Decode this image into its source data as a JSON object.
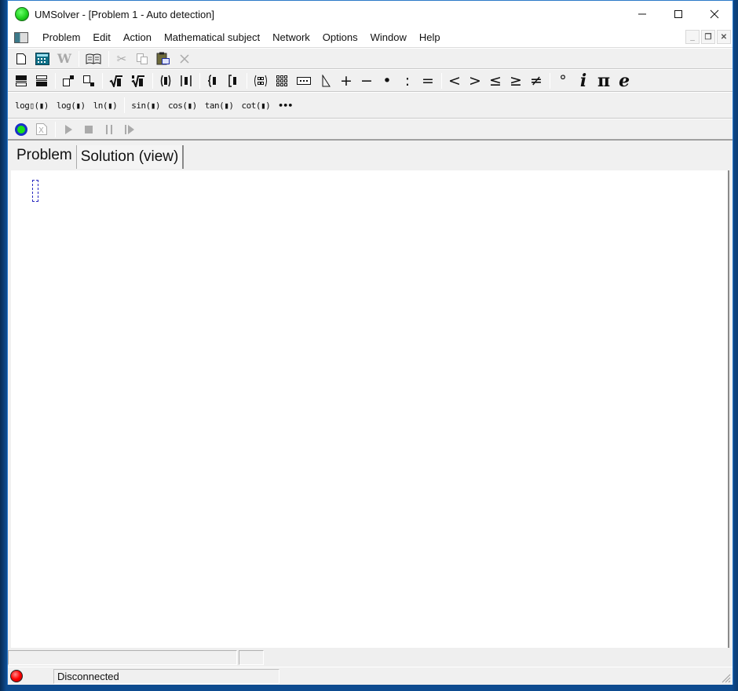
{
  "window": {
    "title": "UMSolver - [Problem 1 - Auto detection]",
    "controls": {
      "minimize": "minimize-icon",
      "maximize": "maximize-icon",
      "close": "close-icon"
    }
  },
  "menu": {
    "items": [
      "Problem",
      "Edit",
      "Action",
      "Mathematical subject",
      "Network",
      "Options",
      "Window",
      "Help"
    ],
    "mdi_controls": [
      "_",
      "❐",
      "✕"
    ]
  },
  "toolbar1": {
    "buttons": [
      {
        "name": "new-document",
        "glyph": "🗋",
        "enabled": true
      },
      {
        "name": "calculator",
        "glyph": "▦",
        "enabled": true
      },
      {
        "name": "word-export",
        "glyph": "W",
        "enabled": false
      },
      {
        "name": "preview",
        "glyph": "🕮",
        "enabled": true
      },
      {
        "name": "cut",
        "glyph": "✂",
        "enabled": false
      },
      {
        "name": "copy",
        "glyph": "⎘",
        "enabled": false
      },
      {
        "name": "paste",
        "glyph": "📋",
        "enabled": true
      },
      {
        "name": "delete",
        "glyph": "✕",
        "enabled": false
      }
    ]
  },
  "toolbar2": {
    "buttons": [
      {
        "name": "fraction-top",
        "glyph": "☰"
      },
      {
        "name": "fraction-bottom",
        "glyph": "☰"
      },
      {
        "name": "superscript",
        "glyph": "□▪"
      },
      {
        "name": "subscript",
        "glyph": "□▪"
      },
      {
        "name": "square-root",
        "glyph": "√▮"
      },
      {
        "name": "nth-root",
        "glyph": "∜▮"
      },
      {
        "name": "parentheses",
        "glyph": "(▮)"
      },
      {
        "name": "absolute-value",
        "glyph": "|▮|"
      },
      {
        "name": "curly-brace",
        "glyph": "{▮"
      },
      {
        "name": "square-bracket",
        "glyph": "[▮"
      },
      {
        "name": "matrix",
        "glyph": "(⁘)"
      },
      {
        "name": "grid",
        "glyph": "⁙"
      },
      {
        "name": "ellipsis-box",
        "glyph": "⋯"
      },
      {
        "name": "angle",
        "glyph": "◺"
      },
      {
        "name": "plus",
        "glyph": "+"
      },
      {
        "name": "minus",
        "glyph": "−"
      },
      {
        "name": "dot",
        "glyph": "•"
      },
      {
        "name": "colon",
        "glyph": ":"
      },
      {
        "name": "equals",
        "glyph": "="
      },
      {
        "name": "less-than",
        "glyph": "<"
      },
      {
        "name": "greater-than",
        "glyph": ">"
      },
      {
        "name": "less-equal",
        "glyph": "≤"
      },
      {
        "name": "greater-equal",
        "glyph": "≥"
      },
      {
        "name": "not-equal",
        "glyph": "≠"
      },
      {
        "name": "degree",
        "glyph": "°"
      },
      {
        "name": "imaginary-i",
        "glyph": "i"
      },
      {
        "name": "pi",
        "glyph": "π"
      },
      {
        "name": "euler-e",
        "glyph": "e"
      }
    ]
  },
  "toolbar3": {
    "buttons": [
      {
        "name": "log-base",
        "label": "log▯(▮)"
      },
      {
        "name": "log",
        "label": "log(▮)"
      },
      {
        "name": "ln",
        "label": "ln(▮)"
      },
      {
        "name": "sin",
        "label": "sin(▮)"
      },
      {
        "name": "cos",
        "label": "cos(▮)"
      },
      {
        "name": "tan",
        "label": "tan(▮)"
      },
      {
        "name": "cot",
        "label": "cot(▮)"
      },
      {
        "name": "more",
        "label": "•••"
      }
    ]
  },
  "toolbar4": {
    "buttons": [
      {
        "name": "connect",
        "enabled": true
      },
      {
        "name": "excel",
        "glyph": "X",
        "enabled": false
      },
      {
        "name": "run",
        "glyph": "▶",
        "enabled": false
      },
      {
        "name": "stop",
        "glyph": "■",
        "enabled": false
      },
      {
        "name": "pause",
        "glyph": "⏸",
        "enabled": false
      },
      {
        "name": "step",
        "glyph": "▶",
        "enabled": false
      }
    ]
  },
  "tabs": [
    {
      "label": "Problem",
      "active": true
    },
    {
      "label": "Solution (view)",
      "active": false
    }
  ],
  "status": {
    "connection": "Disconnected",
    "connection_color": "#ff0000",
    "field1": "",
    "field2": ""
  },
  "colors": {
    "accent_green": "#1fd21f",
    "accent_blue": "#1832c8",
    "window_border": "#2b79c8"
  }
}
